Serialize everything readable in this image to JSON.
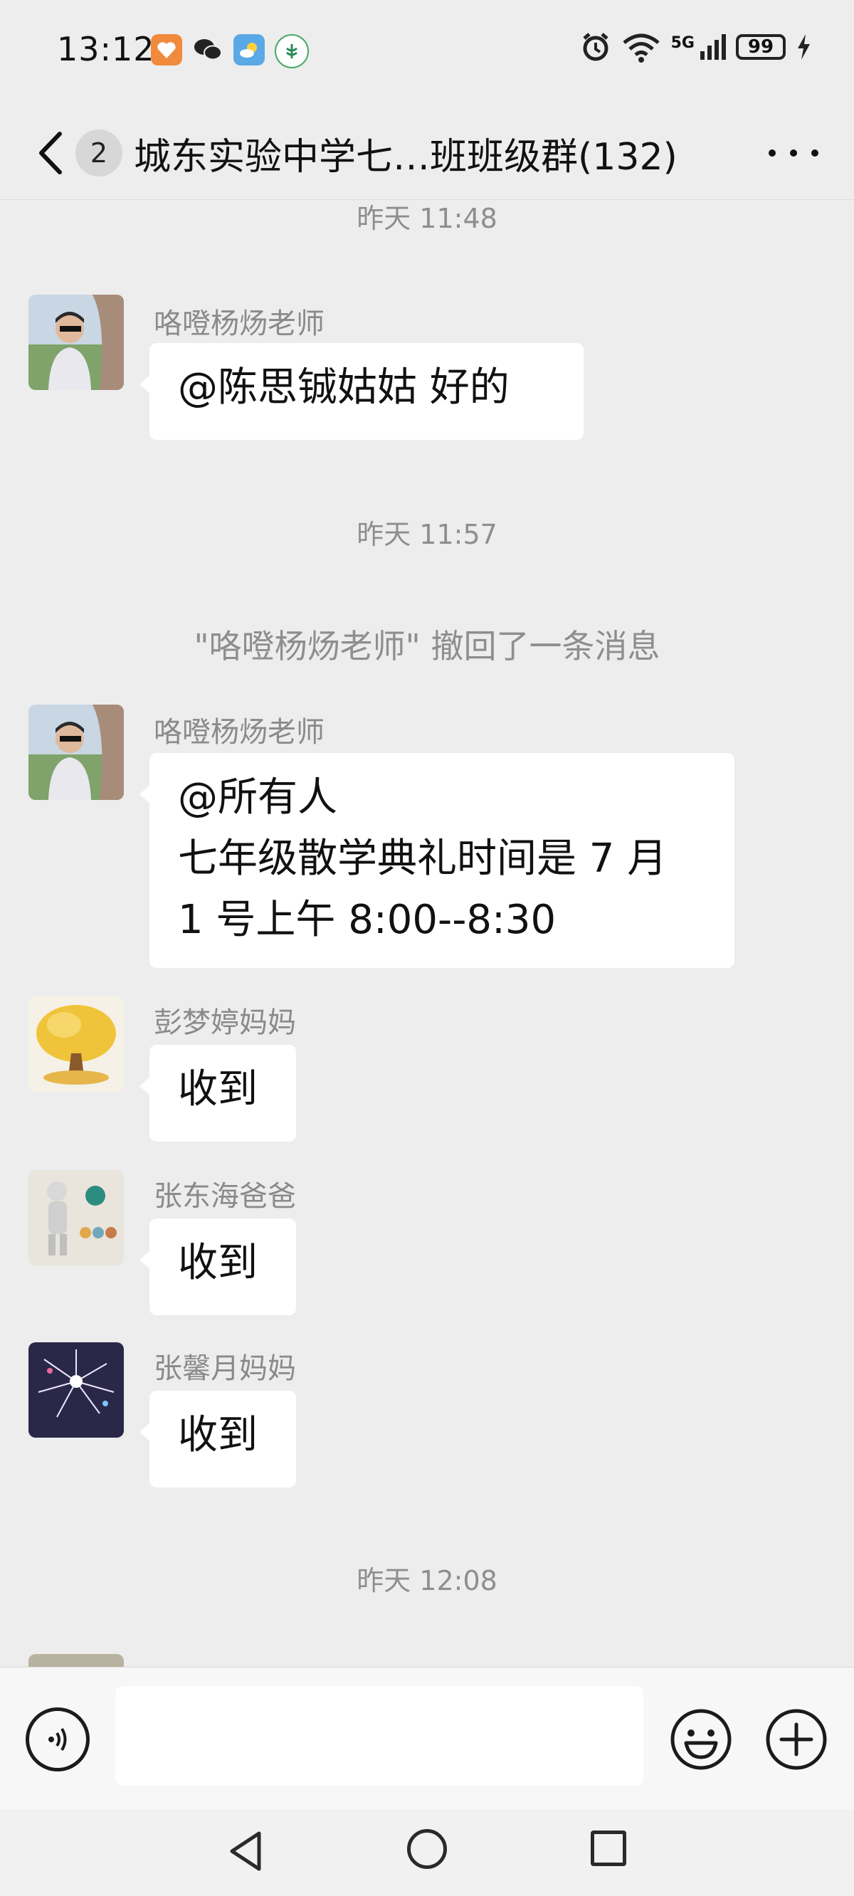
{
  "status_bar": {
    "time": "13:12",
    "app_icons": [
      "taobao-heart-icon",
      "wechat-icon",
      "weather-icon",
      "bank-icon"
    ],
    "network": "5G",
    "battery": "99"
  },
  "header": {
    "unread_count": "2",
    "title": "城东实验中学七…班班级群(132)"
  },
  "messages": [
    {
      "type": "time",
      "text": "昨天 11:48"
    },
    {
      "type": "msg",
      "sender": "咯噔杨炀老师",
      "avatar": "man-photo",
      "text": "@陈思铖姑姑  好的"
    },
    {
      "type": "time",
      "text": "昨天 11:57"
    },
    {
      "type": "system",
      "text": "\"咯噔杨炀老师\" 撤回了一条消息"
    },
    {
      "type": "msg",
      "sender": "咯噔杨炀老师",
      "avatar": "man-photo",
      "text": "@所有人\n七年级散学典礼时间是 7 月\n1 号上午 8:00--8:30"
    },
    {
      "type": "msg",
      "sender": "彭梦婷妈妈",
      "avatar": "golden-tree",
      "text": "收到"
    },
    {
      "type": "msg",
      "sender": "张东海爸爸",
      "avatar": "cartoon-figure",
      "text": "收到"
    },
    {
      "type": "msg",
      "sender": "张馨月妈妈",
      "avatar": "fireworks",
      "text": "收到"
    },
    {
      "type": "time",
      "text": "昨天 12:08"
    },
    {
      "type": "msg_partial",
      "sender": "",
      "avatar": "partial"
    }
  ],
  "input": {
    "value": "",
    "placeholder": ""
  },
  "colors": {
    "background": "#ededed",
    "bubble": "#ffffff",
    "meta_text": "#8e8e8e"
  }
}
